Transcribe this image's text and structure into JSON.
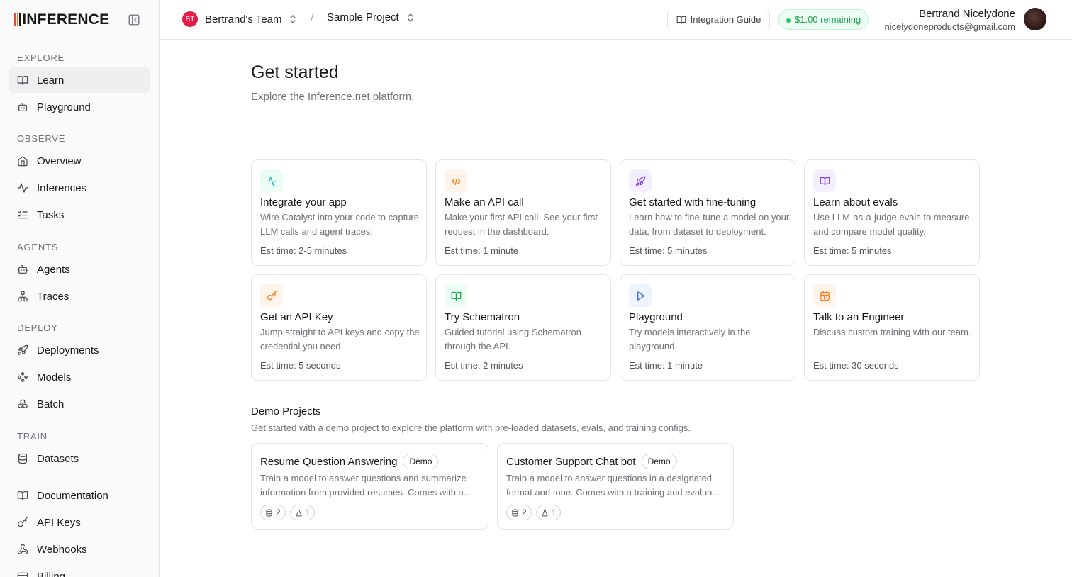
{
  "app": {
    "brand": "INFERENCE"
  },
  "sidebar": {
    "sections": {
      "explore": "EXPLORE",
      "observe": "OBSERVE",
      "agents": "AGENTS",
      "deploy": "DEPLOY",
      "train": "TRAIN"
    },
    "items": {
      "learn": "Learn",
      "playground": "Playground",
      "overview": "Overview",
      "inferences": "Inferences",
      "tasks": "Tasks",
      "agents": "Agents",
      "traces": "Traces",
      "deployments": "Deployments",
      "models": "Models",
      "batch": "Batch",
      "datasets": "Datasets",
      "documentation": "Documentation",
      "api_keys": "API Keys",
      "webhooks": "Webhooks",
      "billing": "Billing"
    },
    "active": "learn"
  },
  "header": {
    "team_initials": "BT",
    "team_name": "Bertrand's Team",
    "separator": "/",
    "project_name": "Sample Project",
    "guide_label": "Integration Guide",
    "credit_label": "$1.00 remaining",
    "user_name": "Bertrand Nicelydone",
    "user_email": "nicelydoneproducts@gmail.com"
  },
  "page": {
    "title": "Get started",
    "subtitle": "Explore the Inference.net platform."
  },
  "cards": [
    {
      "title": "Integrate your app",
      "desc": "Wire Catalyst into your code to capture LLM calls and agent traces.",
      "time": "Est time: 2-5 minutes",
      "icon": "activity-icon"
    },
    {
      "title": "Make an API call",
      "desc": "Make your first API call. See your first request in the dashboard.",
      "time": "Est time: 1 minute",
      "icon": "code-icon"
    },
    {
      "title": "Get started with fine-tuning",
      "desc": "Learn how to fine-tune a model on your data, from dataset to deployment.",
      "time": "Est time: 5 minutes",
      "icon": "rocket-icon"
    },
    {
      "title": "Learn about evals",
      "desc": "Use LLM-as-a-judge evals to measure and compare model quality.",
      "time": "Est time: 5 minutes",
      "icon": "book-icon"
    },
    {
      "title": "Get an API Key",
      "desc": "Jump straight to API keys and copy the credential you need.",
      "time": "Est time: 5 seconds",
      "icon": "key-icon"
    },
    {
      "title": "Try Schematron",
      "desc": "Guided tutorial using Schematron through the API.",
      "time": "Est time: 2 minutes",
      "icon": "book-open-icon"
    },
    {
      "title": "Playground",
      "desc": "Try models interactively in the playground.",
      "time": "Est time: 1 minute",
      "icon": "play-icon"
    },
    {
      "title": "Talk to an Engineer",
      "desc": "Discuss custom training with our team.",
      "time": "Est time: 30 seconds",
      "icon": "calendar-clock-icon"
    }
  ],
  "demo": {
    "heading": "Demo Projects",
    "subtitle": "Get started with a demo project to explore the platform with pre-loaded datasets, evals, and training configs.",
    "projects": [
      {
        "title": "Resume Question Answering",
        "badge": "Demo",
        "line1": "Train a model to answer questions and summarize",
        "line2": "information from provided resumes. Comes with a training and evaluation dataset.",
        "datasets": "2",
        "evals": "1"
      },
      {
        "title": "Customer Support Chat bot",
        "badge": "Demo",
        "line1": "Train a model to answer questions in a designated",
        "line2": "format and tone. Comes with a training and evaluation dataset.",
        "datasets": "2",
        "evals": "1"
      }
    ]
  },
  "colors": {
    "accent_green": "#16a34a",
    "team_avatar": "#e11d48",
    "icon_teal": "#14b8a6",
    "icon_orange": "#f97316",
    "icon_violet": "#7c3aed",
    "icon_green": "#16a34a",
    "icon_blue": "#2563eb"
  }
}
